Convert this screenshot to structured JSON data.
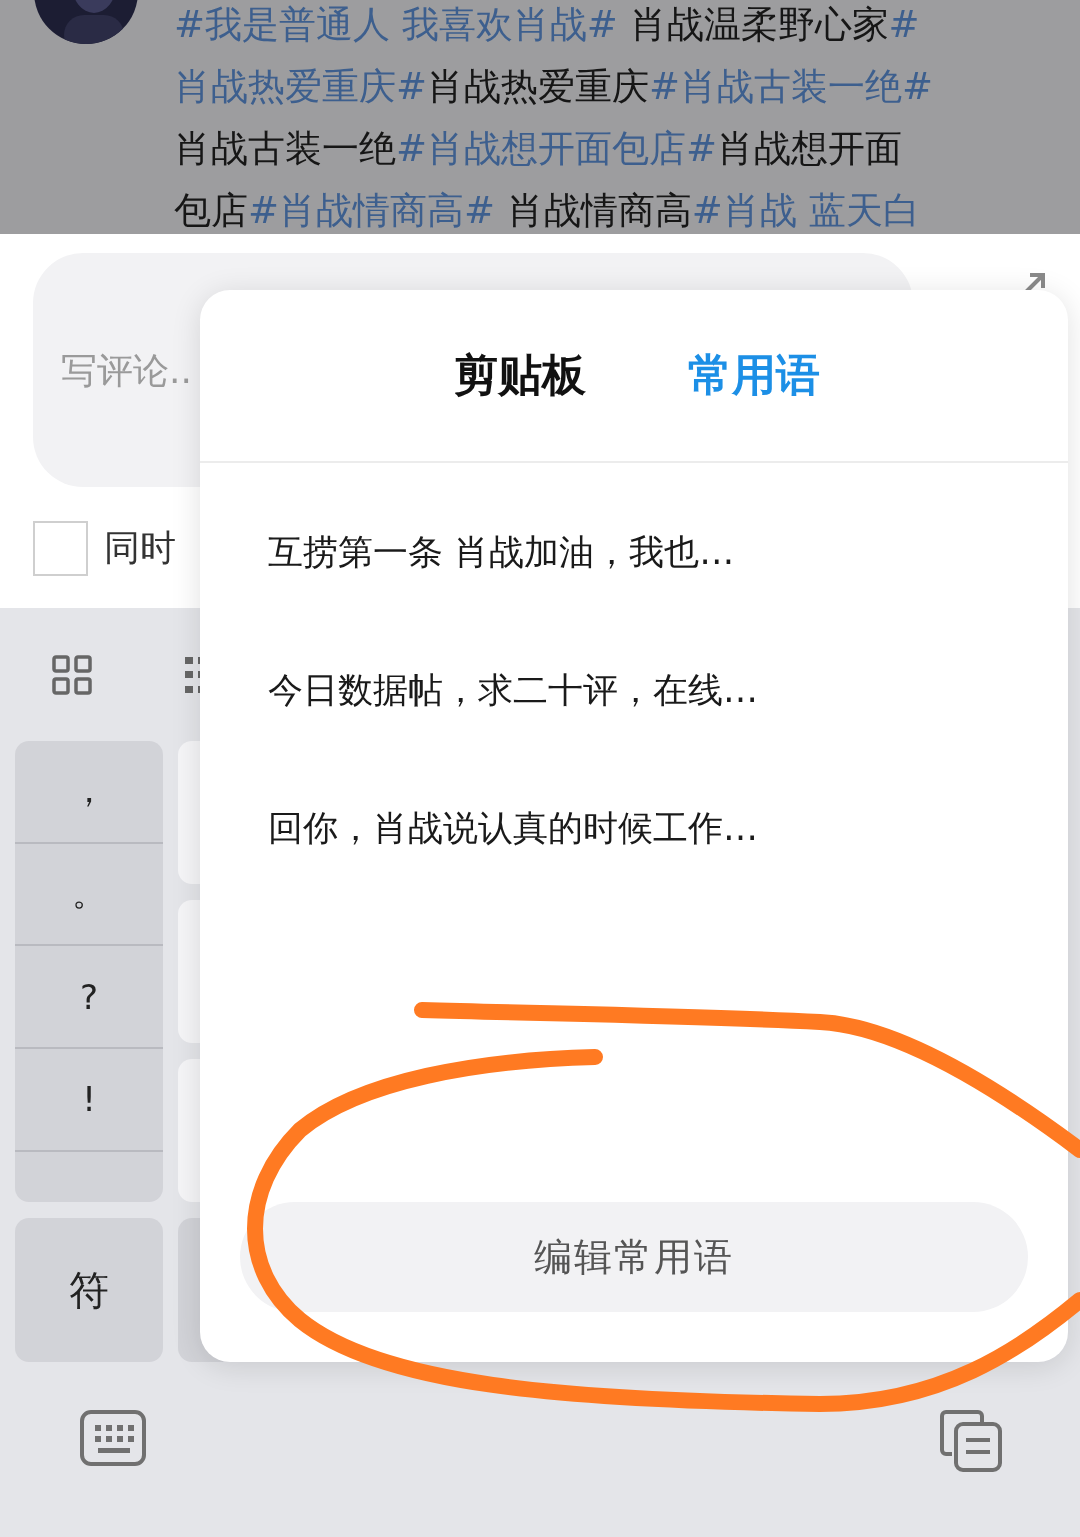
{
  "post": {
    "avatar": {
      "kind": "picture"
    },
    "lines": [
      [
        {
          "text": "#我是普通人 我喜欢肖战#",
          "kind": "tag"
        },
        {
          "text": " 肖战温柔野心家",
          "kind": "plain"
        },
        {
          "text": "#",
          "kind": "tag"
        }
      ],
      [
        {
          "text": "肖战热爱重庆#",
          "kind": "tag"
        },
        {
          "text": "肖战热爱重庆",
          "kind": "plain"
        },
        {
          "text": "#肖战古装一绝#",
          "kind": "tag"
        }
      ],
      [
        {
          "text": "肖战古装一绝",
          "kind": "plain"
        },
        {
          "text": "#肖战想开面包店#",
          "kind": "tag"
        },
        {
          "text": "肖战想开面",
          "kind": "plain"
        }
      ],
      [
        {
          "text": "包店",
          "kind": "plain"
        },
        {
          "text": "#肖战情商高#",
          "kind": "tag"
        },
        {
          "text": " 肖战情商高",
          "kind": "plain"
        },
        {
          "text": "#肖战 蓝天白",
          "kind": "tag"
        }
      ]
    ]
  },
  "comment": {
    "placeholder": "写评论..",
    "repost": {
      "label": "同时",
      "checked": false
    }
  },
  "keyboard": {
    "punctuation": [
      "，",
      "。",
      "?",
      "!"
    ],
    "symbol_key": "符"
  },
  "popup": {
    "tabs": [
      {
        "label": "剪贴板",
        "selected": false
      },
      {
        "label": "常用语",
        "selected": true
      }
    ],
    "phrases": [
      "互捞第一条 肖战加油，我也…",
      "今日数据帖，求二十评，在线…",
      "回你，肖战说认真的时候工作…"
    ],
    "edit_button": "编辑常用语"
  },
  "annotation": {
    "kind": "scribble",
    "color": "#ff7a22"
  }
}
